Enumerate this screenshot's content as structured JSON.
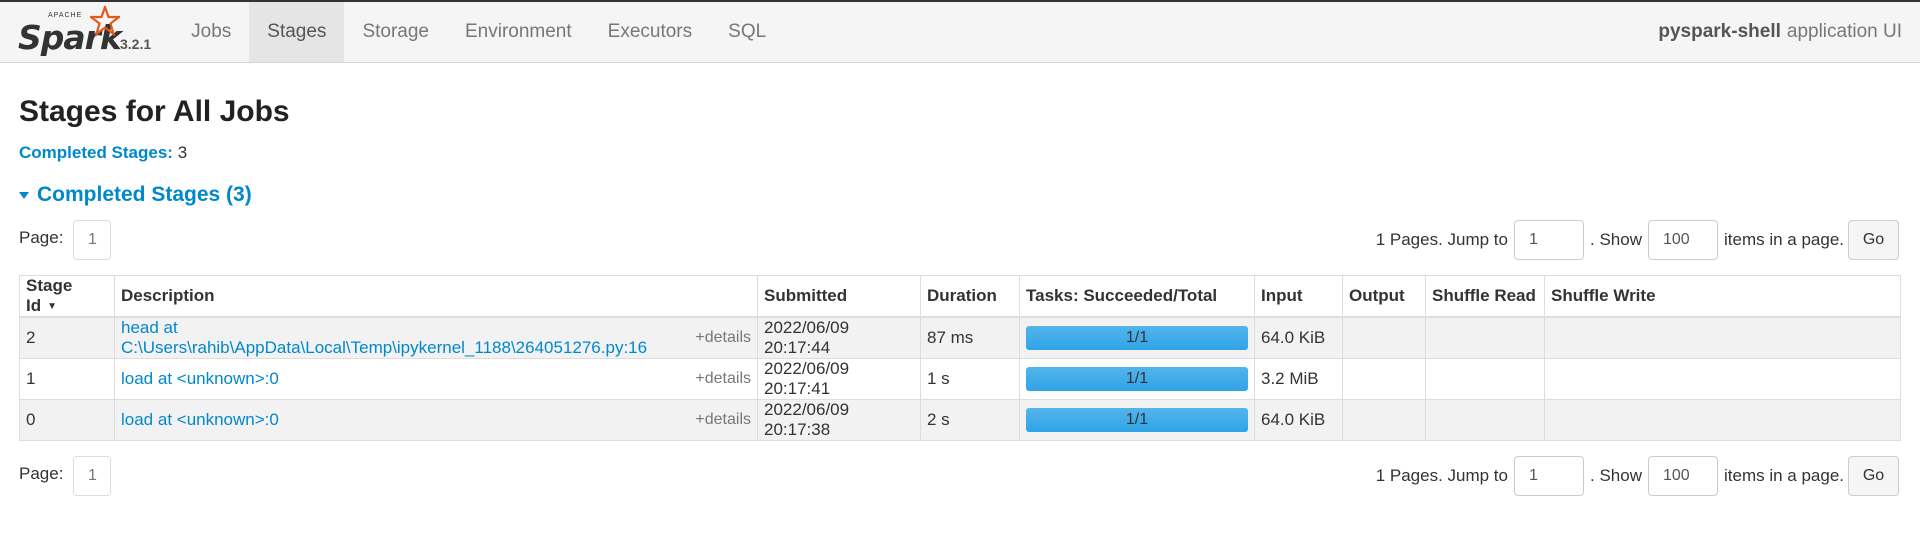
{
  "brand": {
    "apache": "APACHE",
    "name": "Spark",
    "version": "3.2.1"
  },
  "nav": {
    "tabs": [
      {
        "label": "Jobs"
      },
      {
        "label": "Stages",
        "active": true
      },
      {
        "label": "Storage"
      },
      {
        "label": "Environment"
      },
      {
        "label": "Executors"
      },
      {
        "label": "SQL"
      }
    ],
    "app_name": "pyspark-shell",
    "app_suffix": "application UI"
  },
  "page": {
    "title": "Stages for All Jobs",
    "summary_label": "Completed Stages:",
    "summary_value": "3",
    "section_title": "Completed Stages (3)"
  },
  "pager": {
    "page_label": "Page:",
    "current_page": "1",
    "pages_text": "1 Pages. Jump to",
    "jump_value": "1",
    "show_text": ". Show",
    "show_value": "100",
    "items_text": "items in a page.",
    "go_label": "Go"
  },
  "table": {
    "headers": [
      "Stage Id",
      "Description",
      "Submitted",
      "Duration",
      "Tasks: Succeeded/Total",
      "Input",
      "Output",
      "Shuffle Read",
      "Shuffle Write"
    ],
    "details_label": "+details",
    "rows": [
      {
        "id": "2",
        "desc": "head at C:\\Users\\rahib\\AppData\\Local\\Temp\\ipykernel_1188\\264051276.py:16",
        "submitted": "2022/06/09 20:17:44",
        "duration": "87 ms",
        "tasks": "1/1",
        "input": "64.0 KiB",
        "output": "",
        "shuffle_read": "",
        "shuffle_write": ""
      },
      {
        "id": "1",
        "desc": "load at <unknown>:0",
        "submitted": "2022/06/09 20:17:41",
        "duration": "1 s",
        "tasks": "1/1",
        "input": "3.2 MiB",
        "output": "",
        "shuffle_read": "",
        "shuffle_write": ""
      },
      {
        "id": "0",
        "desc": "load at <unknown>:0",
        "submitted": "2022/06/09 20:17:38",
        "duration": "2 s",
        "tasks": "1/1",
        "input": "64.0 KiB",
        "output": "",
        "shuffle_read": "",
        "shuffle_write": ""
      }
    ]
  },
  "colors": {
    "link": "#0088cc",
    "progress": "#2fa4e7"
  },
  "icons": {
    "sort": "sort-descending-icon",
    "collapse": "collapse-triangle-icon",
    "logo_star": "spark-star-icon"
  }
}
